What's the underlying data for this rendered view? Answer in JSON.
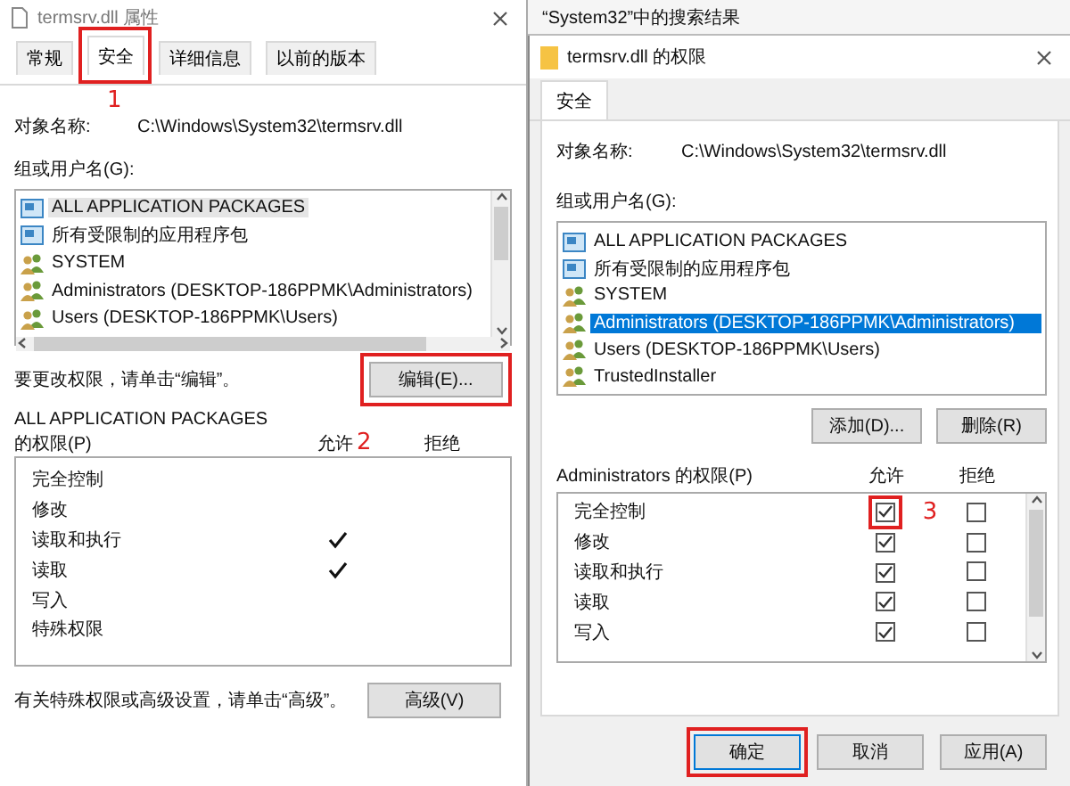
{
  "properties_window": {
    "title": "termsrv.dll 属性",
    "tabs": [
      {
        "label": "常规",
        "selected": false,
        "highlighted": false
      },
      {
        "label": "安全",
        "selected": true,
        "highlighted": true
      },
      {
        "label": "详细信息",
        "selected": false,
        "highlighted": false
      },
      {
        "label": "以前的版本",
        "selected": false,
        "highlighted": false
      }
    ],
    "tab_step": "1",
    "object_label": "对象名称:",
    "object_path": "C:\\Windows\\System32\\termsrv.dll",
    "groups_label": "组或用户名(G):",
    "groups": [
      {
        "name": "ALL APPLICATION PACKAGES",
        "kind": "package",
        "selected": true
      },
      {
        "name": "所有受限制的应用程序包",
        "kind": "package",
        "selected": false
      },
      {
        "name": "SYSTEM",
        "kind": "user",
        "selected": false
      },
      {
        "name": "Administrators (DESKTOP-186PPMK\\Administrators)",
        "kind": "user",
        "selected": false
      },
      {
        "name": "Users (DESKTOP-186PPMK\\Users)",
        "kind": "user",
        "selected": false
      }
    ],
    "edit_hint": "要更改权限，请单击“编辑”。",
    "edit_button": {
      "label": "编辑(E)...",
      "highlighted": true
    },
    "perm_subject": "ALL APPLICATION PACKAGES",
    "perm_label": "的权限(P)",
    "allow_header": "允许",
    "allow_step": "2",
    "deny_header": "拒绝",
    "permissions": [
      {
        "name": "完全控制",
        "allow": false,
        "deny": false
      },
      {
        "name": "修改",
        "allow": false,
        "deny": false
      },
      {
        "name": "读取和执行",
        "allow": true,
        "deny": false
      },
      {
        "name": "读取",
        "allow": true,
        "deny": false
      },
      {
        "name": "写入",
        "allow": false,
        "deny": false
      },
      {
        "name": "特殊权限",
        "allow": false,
        "deny": false
      }
    ],
    "advanced_hint": "有关特殊权限或高级设置，请单击“高级”。",
    "advanced_button": "高级(V)"
  },
  "permissions_dialog": {
    "search_bar": "“System32”中的搜索结果",
    "title": "termsrv.dll 的权限",
    "tabs": [
      {
        "label": "安全",
        "selected": true
      }
    ],
    "object_label": "对象名称:",
    "object_path": "C:\\Windows\\System32\\termsrv.dll",
    "groups_label": "组或用户名(G):",
    "groups": [
      {
        "name": "ALL APPLICATION PACKAGES",
        "kind": "package",
        "selected": false
      },
      {
        "name": "所有受限制的应用程序包",
        "kind": "package",
        "selected": false
      },
      {
        "name": "SYSTEM",
        "kind": "user",
        "selected": false
      },
      {
        "name": "Administrators (DESKTOP-186PPMK\\Administrators)",
        "kind": "user",
        "selected": true
      },
      {
        "name": "Users (DESKTOP-186PPMK\\Users)",
        "kind": "user",
        "selected": false
      },
      {
        "name": "TrustedInstaller",
        "kind": "user",
        "selected": false
      }
    ],
    "add_button": "添加(D)...",
    "remove_button": "删除(R)",
    "perm_label": "Administrators 的权限(P)",
    "allow_header": "允许",
    "deny_header": "拒绝",
    "permissions": [
      {
        "name": "完全控制",
        "allow": true,
        "deny": false,
        "highlighted": true,
        "step": "3"
      },
      {
        "name": "修改",
        "allow": true,
        "deny": false,
        "highlighted": false
      },
      {
        "name": "读取和执行",
        "allow": true,
        "deny": false,
        "highlighted": false
      },
      {
        "name": "读取",
        "allow": true,
        "deny": false,
        "highlighted": false
      },
      {
        "name": "写入",
        "allow": true,
        "deny": false,
        "highlighted": false
      }
    ],
    "buttons": [
      {
        "label": "确定",
        "kind": "ok",
        "highlighted": true
      },
      {
        "label": "取消",
        "kind": "cancel",
        "highlighted": false
      },
      {
        "label": "应用(A)",
        "kind": "apply",
        "highlighted": false
      }
    ]
  }
}
